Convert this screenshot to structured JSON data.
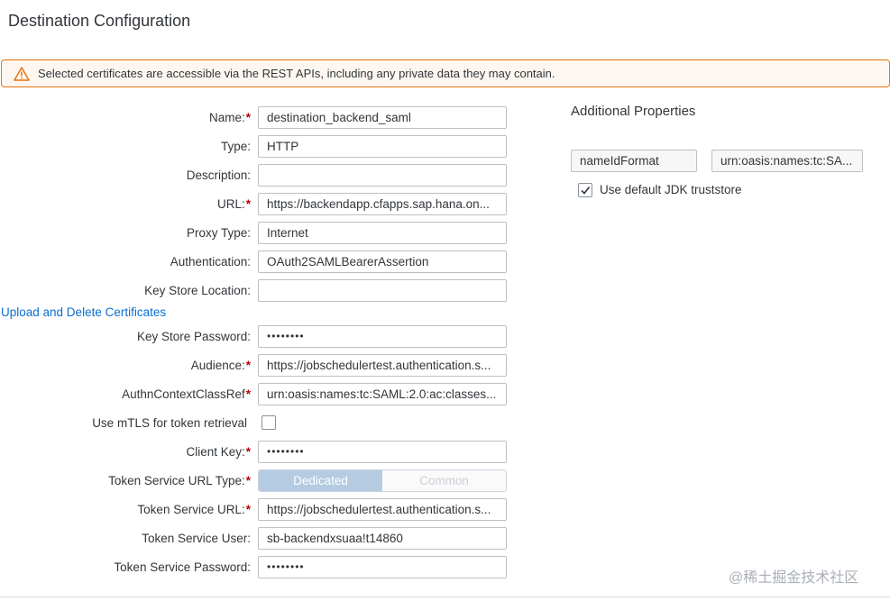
{
  "page": {
    "title": "Destination Configuration"
  },
  "warning": {
    "message": "Selected certificates are accessible via the REST APIs, including any private data they may contain."
  },
  "form": {
    "name": {
      "label": "Name:",
      "value": "destination_backend_saml"
    },
    "type": {
      "label": "Type:",
      "value": "HTTP"
    },
    "description": {
      "label": "Description:",
      "value": ""
    },
    "url": {
      "label": "URL:",
      "value": "https://backendapp.cfapps.sap.hana.on..."
    },
    "proxy_type": {
      "label": "Proxy Type:",
      "value": "Internet"
    },
    "authentication": {
      "label": "Authentication:",
      "value": "OAuth2SAMLBearerAssertion"
    },
    "key_store_location": {
      "label": "Key Store Location:",
      "value": ""
    },
    "upload_link": "Upload and Delete Certificates",
    "key_store_password": {
      "label": "Key Store Password:",
      "value": "••••••••"
    },
    "audience": {
      "label": "Audience:",
      "value": "https://jobschedulertest.authentication.s..."
    },
    "authn_context": {
      "label": "AuthnContextClassRef",
      "value": "urn:oasis:names:tc:SAML:2.0:ac:classes..."
    },
    "use_mtls": {
      "label": "Use mTLS for token retrieval",
      "checked": false
    },
    "client_key": {
      "label": "Client Key:",
      "value": "••••••••"
    },
    "token_service_url_type": {
      "label": "Token Service URL Type:",
      "options": [
        "Dedicated",
        "Common"
      ],
      "selected": "Dedicated"
    },
    "token_service_url": {
      "label": "Token Service URL:",
      "value": "https://jobschedulertest.authentication.s..."
    },
    "token_service_user": {
      "label": "Token Service User:",
      "value": "sb-backendxsuaa!t14860"
    },
    "token_service_password": {
      "label": "Token Service Password:",
      "value": "••••••••"
    }
  },
  "additional": {
    "title": "Additional Properties",
    "property_key": "nameIdFormat",
    "property_value": "urn:oasis:names:tc:SA...",
    "jdk_truststore": {
      "label": "Use default JDK truststore",
      "checked": true
    }
  },
  "watermark": "@稀土掘金技术社区",
  "colors": {
    "warning_border": "#e9730c",
    "link": "#0a6ed1",
    "required": "#bb0000",
    "segment_active": "#b5cbe2"
  }
}
